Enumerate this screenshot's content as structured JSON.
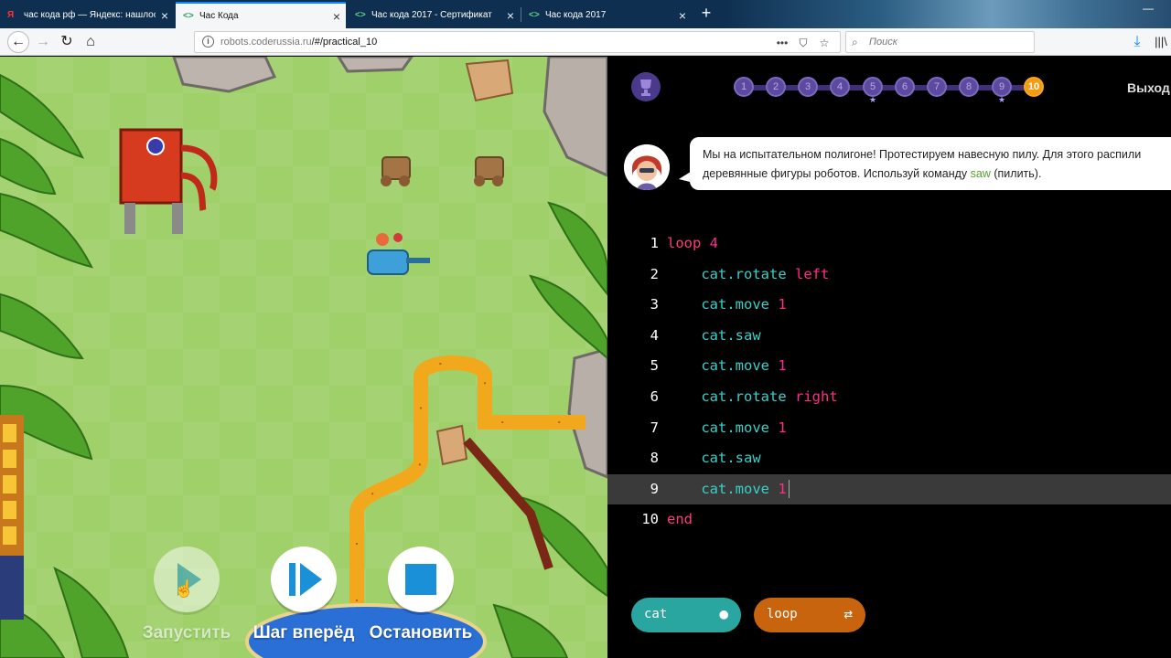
{
  "browser": {
    "tabs": [
      {
        "label": "час кода рф — Яндекс: нашлось",
        "icon": "Я"
      },
      {
        "label": "Час Кода",
        "icon": "<>"
      },
      {
        "label": "Час кода 2017 - Сертификат",
        "icon": "<>"
      },
      {
        "label": "Час кода 2017",
        "icon": "<>"
      }
    ],
    "url_host": "robots.coderussia.ru",
    "url_path": "/#/practical_10",
    "search_placeholder": "Поиск"
  },
  "game": {
    "controls": {
      "run_label": "Запустить",
      "step_label": "Шаг вперёд",
      "stop_label": "Остановить"
    }
  },
  "panel": {
    "levels": [
      "1",
      "2",
      "3",
      "4",
      "5",
      "6",
      "7",
      "8",
      "9",
      "10"
    ],
    "current_level": "10",
    "exit_label": "Выход",
    "message_before": "Мы на испытательном полигоне! Протестируем навесную пилу. Для этого распили деревянные фигуры роботов. Используй команду ",
    "message_keyword": "saw",
    "message_after": " (пилить).",
    "code_lines": [
      {
        "n": "1",
        "indent": "",
        "obj": "",
        "kw": "loop",
        "arg": " 4"
      },
      {
        "n": "2",
        "indent": "    ",
        "obj": "cat.rotate",
        "kw": "",
        "arg": " left"
      },
      {
        "n": "3",
        "indent": "    ",
        "obj": "cat.move",
        "kw": "",
        "arg": " 1"
      },
      {
        "n": "4",
        "indent": "    ",
        "obj": "cat.saw",
        "kw": "",
        "arg": ""
      },
      {
        "n": "5",
        "indent": "    ",
        "obj": "cat.move",
        "kw": "",
        "arg": " 1"
      },
      {
        "n": "6",
        "indent": "    ",
        "obj": "cat.rotate",
        "kw": "",
        "arg": " right"
      },
      {
        "n": "7",
        "indent": "    ",
        "obj": "cat.move",
        "kw": "",
        "arg": " 1"
      },
      {
        "n": "8",
        "indent": "    ",
        "obj": "cat.saw",
        "kw": "",
        "arg": ""
      },
      {
        "n": "9",
        "indent": "    ",
        "obj": "cat.move",
        "kw": "",
        "arg": " 1"
      },
      {
        "n": "10",
        "indent": "",
        "obj": "",
        "kw": "end",
        "arg": ""
      }
    ],
    "highlighted_line": "9",
    "chips": [
      {
        "label": "cat",
        "color": "#2aa6a0"
      },
      {
        "label": "loop",
        "color": "#c8640e"
      }
    ]
  }
}
